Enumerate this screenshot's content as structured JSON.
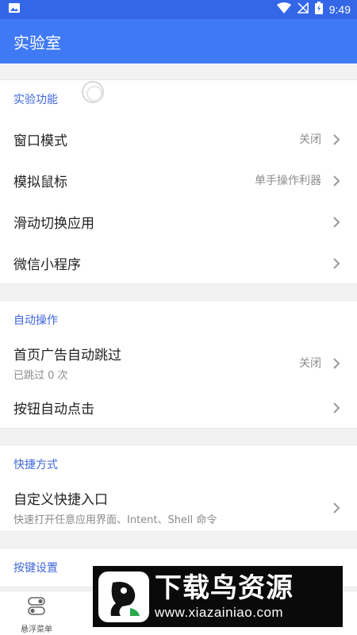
{
  "status_bar": {
    "time": "9:49",
    "icons": [
      "image-icon",
      "wifi-icon",
      "no-signal-icon",
      "battery-charging-icon"
    ]
  },
  "app_bar": {
    "title": "实验室"
  },
  "sections": [
    {
      "header": "实验功能",
      "items": [
        {
          "title": "窗口模式",
          "value": "关闭"
        },
        {
          "title": "模拟鼠标",
          "value": "单手操作利器"
        },
        {
          "title": "滑动切换应用"
        },
        {
          "title": "微信小程序"
        }
      ]
    },
    {
      "header": "自动操作",
      "items": [
        {
          "title": "首页广告自动跳过",
          "subtitle": "已跳过 0 次",
          "value": "关闭"
        },
        {
          "title": "按钮自动点击"
        }
      ]
    },
    {
      "header": "快捷方式",
      "items": [
        {
          "title": "自定义快捷入口",
          "subtitle": "快速打开任意应用界面、Intent、Shell 命令"
        }
      ]
    },
    {
      "header": "按键设置",
      "items": []
    }
  ],
  "bottom_nav": {
    "items": [
      {
        "label": "悬浮菜单",
        "icon": "toggle-icon"
      }
    ]
  },
  "watermark": {
    "title": "下载鸟资源",
    "url": "www.xiazainiao.com"
  },
  "colors": {
    "status_bar": "#3467e8",
    "app_bar": "#3f79f4",
    "section_header": "#3f67d8"
  }
}
